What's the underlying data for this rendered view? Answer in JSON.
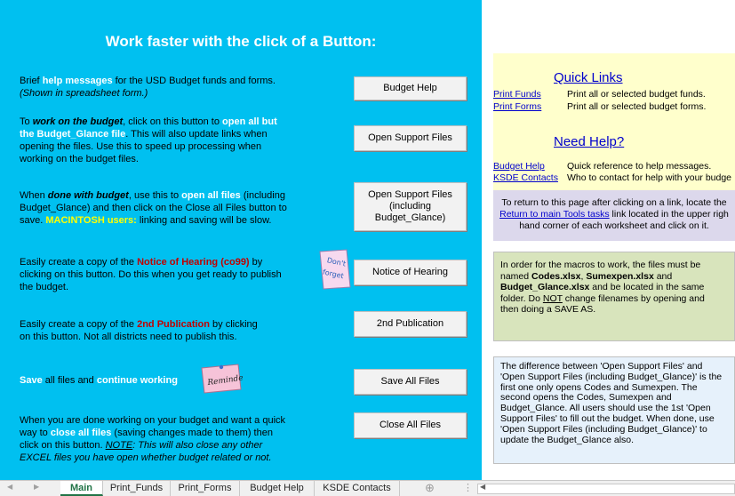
{
  "left": {
    "title": "Work faster with the click of a Button:",
    "row1": {
      "a": "Brief ",
      "b": "help messages",
      "c": " for the USD Budget funds and forms.",
      "d": "(Shown in spreadsheet form.)"
    },
    "row2": {
      "a": "To ",
      "b": "work on the budget",
      "c": ", click on this button to ",
      "d": "open all but",
      "e": "the Budget_Glance file",
      "f": ". This will also update links when",
      "g": "opening the files.  Use this to speed up processing when",
      "h": "working on the budget files."
    },
    "row3": {
      "a": "When ",
      "b": "done with budget",
      "c": ", use this to ",
      "d": "open all files",
      "e": " (including",
      "f": "Budget_Glance) and then click on the Close all Files button to",
      "g": "save.  ",
      "h": "MACINTOSH users:",
      "i": " linking and saving will be slow."
    },
    "row4": {
      "a": "Easily create a copy of the ",
      "b": "Notice of Hearing  (co99)",
      "c": " by",
      "d": "clicking on this button.  Do this when you get ready to publish",
      "e": "the budget."
    },
    "row5": {
      "a": "Easily create a copy of the ",
      "b": "2nd Publication",
      "c": " by clicking",
      "d": "on this button.  Not all districts need to publish this."
    },
    "row6": {
      "a": "Save",
      "b": " all files and ",
      "c": "continue working"
    },
    "row7": {
      "a": "When you are done working on your budget and want a quick",
      "b": "way to ",
      "c": "close all files",
      "d": " (saving changes made to them) then",
      "e": "click on this button.  ",
      "f": "NOTE",
      "g": ":  This will also close any other",
      "h": "EXCEL files you have open whether budget related or not."
    },
    "sticker_dont_forget": "Don't forget",
    "sticker_reminder": "Reminder!"
  },
  "buttons": {
    "budget_help": "Budget Help",
    "open_support": "Open Support Files",
    "open_support_bg_1": "Open Support Files",
    "open_support_bg_2": "(including",
    "open_support_bg_3": "Budget_Glance)",
    "notice": "Notice of Hearing",
    "second_pub": "2nd Publication",
    "save_all": "Save All Files",
    "close_all": "Close All Files"
  },
  "right": {
    "quick_links": "Quick Links",
    "print_funds": "Print Funds",
    "print_funds_desc": "Print all or selected budget funds.",
    "print_forms": "Print Forms",
    "print_forms_desc": "Print all or selected budget forms.",
    "need_help": "Need Help?",
    "budget_help": "Budget Help",
    "budget_help_desc": "Quick reference to help messages.",
    "ksde_contacts": "KSDE Contacts",
    "ksde_contacts_desc": "Who to contact for help with your budge",
    "return_1": "To return to this page after clicking on a link, locate the",
    "return_link": "Return to main Tools tasks",
    "return_2": " link located in the upper righ",
    "return_3": "hand corner of each worksheet and click on it.",
    "macro": {
      "a": "In order for the macros to work, the files must be",
      "b": "named ",
      "c": "Codes.xlsx",
      "d": ", ",
      "e": "Sumexpen.xlsx",
      "f": " and",
      "g": "Budget_Glance.xlsx",
      "h": " and be located in the same",
      "i": "folder.  Do ",
      "j": "NOT",
      "k": " change filenames by opening and",
      "l": "then doing a SAVE AS."
    },
    "diff": [
      "The difference between 'Open Support Files' and",
      "'Open Support Files (including Budget_Glance)' is the",
      "first one only opens Codes and Sumexpen.   The",
      "second opens the Codes, Sumexpen and",
      "Budget_Glance. All users should use the 1st 'Open",
      "Support Files' to fill out the budget.  When done, use",
      "'Open Support Files (including Budget_Glance)' to",
      "update the Budget_Glance also."
    ]
  },
  "tabs": [
    "Main",
    "Print_Funds",
    "Print_Forms",
    "Budget Help",
    "KSDE Contacts"
  ],
  "tab_nav": {
    "prev": "◀",
    "next": "▶",
    "add": "⊕",
    "menu": "⋮"
  }
}
